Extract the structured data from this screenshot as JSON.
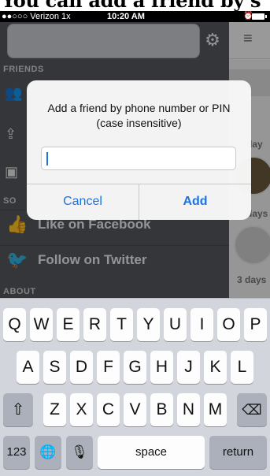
{
  "caption": "You can add a friend by s",
  "status": {
    "carrier": "●●○○○ Verizon  1x",
    "time": "10:20 AM",
    "alarm": "⏰"
  },
  "sidebar": {
    "gear_icon": "gear-icon",
    "sections": {
      "friends": "FRIENDS",
      "social": "SO",
      "about": "ABOUT"
    },
    "rows": [
      {
        "label": "Like on Facebook",
        "icon": "facebook-thumb-icon"
      },
      {
        "label": "Follow on Twitter",
        "icon": "twitter-bird-icon"
      }
    ]
  },
  "right_pane": {
    "menu_icon": "hamburger-icon",
    "texts": [
      "day",
      "days",
      "3 days"
    ]
  },
  "alert": {
    "message": "Add a friend by phone number or PIN (case insensitive)",
    "input_value": "",
    "cancel_label": "Cancel",
    "add_label": "Add"
  },
  "keyboard": {
    "row1": [
      "Q",
      "W",
      "E",
      "R",
      "T",
      "Y",
      "U",
      "I",
      "O",
      "P"
    ],
    "row2": [
      "A",
      "S",
      "D",
      "F",
      "G",
      "H",
      "J",
      "K",
      "L"
    ],
    "row3": [
      "Z",
      "X",
      "C",
      "V",
      "B",
      "N",
      "M"
    ],
    "shift": "⇧",
    "delete": "⌫",
    "numbers": "123",
    "globe": "🌐",
    "mic": "🎙",
    "space": "space",
    "return": "return"
  },
  "colors": {
    "accent": "#1a73e8",
    "sidebar": "#55585d",
    "keyboard": "#d2d5db"
  }
}
